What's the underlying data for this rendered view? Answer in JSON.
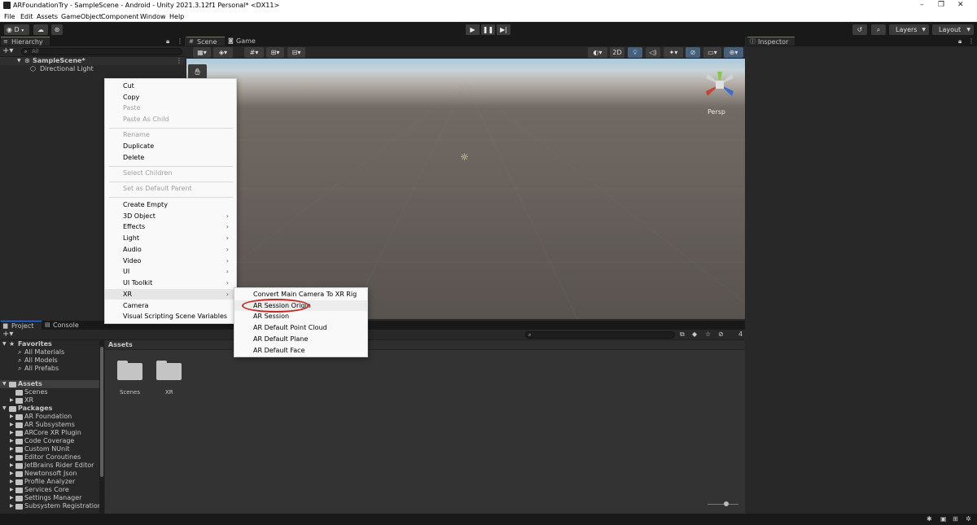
{
  "window": {
    "title": "ARFoundationTry - SampleScene - Android - Unity 2021.3.12f1 Personal* <DX11>",
    "controls": [
      "–",
      "❐",
      "✕"
    ]
  },
  "menubar": [
    "File",
    "Edit",
    "Assets",
    "GameObject",
    "Component",
    "Window",
    "Help"
  ],
  "toolbar": {
    "account_label": "D",
    "layers_label": "Layers",
    "layout_label": "Layout"
  },
  "hierarchy": {
    "tab_label": "Hierarchy",
    "search_placeholder": "All",
    "scene_name": "SampleScene*",
    "children": [
      "Directional Light"
    ]
  },
  "scene": {
    "tabs": [
      "Scene",
      "Game"
    ],
    "mode_2d": "2D",
    "persp_label": "Persp"
  },
  "inspector": {
    "tab_label": "Inspector"
  },
  "context_menu": {
    "items": [
      {
        "label": "Cut",
        "disabled": false
      },
      {
        "label": "Copy",
        "disabled": false
      },
      {
        "label": "Paste",
        "disabled": true
      },
      {
        "label": "Paste As Child",
        "disabled": true
      },
      {
        "label": "Rename",
        "disabled": true
      },
      {
        "label": "Duplicate",
        "disabled": false
      },
      {
        "label": "Delete",
        "disabled": false
      },
      {
        "label": "Select Children",
        "disabled": true
      },
      {
        "label": "Set as Default Parent",
        "disabled": true
      },
      {
        "label": "Create Empty",
        "disabled": false
      },
      {
        "label": "3D Object",
        "disabled": false,
        "submenu": true
      },
      {
        "label": "Effects",
        "disabled": false,
        "submenu": true
      },
      {
        "label": "Light",
        "disabled": false,
        "submenu": true
      },
      {
        "label": "Audio",
        "disabled": false,
        "submenu": true
      },
      {
        "label": "Video",
        "disabled": false,
        "submenu": true
      },
      {
        "label": "UI",
        "disabled": false,
        "submenu": true
      },
      {
        "label": "UI Toolkit",
        "disabled": false,
        "submenu": true
      },
      {
        "label": "XR",
        "disabled": false,
        "submenu": true
      },
      {
        "label": "Camera",
        "disabled": false
      },
      {
        "label": "Visual Scripting Scene Variables",
        "disabled": false
      }
    ]
  },
  "xr_submenu": {
    "items": [
      "Convert Main Camera To XR Rig",
      "AR Session Origin",
      "AR Session",
      "AR Default Point Cloud",
      "AR Default Plane",
      "AR Default Face"
    ],
    "highlighted": "AR Session Origin",
    "highlight_color": "#c62828"
  },
  "project": {
    "tabs": [
      "Project",
      "Console"
    ],
    "favorites_label": "Favorites",
    "favorites": [
      "All Materials",
      "All Models",
      "All Prefabs"
    ],
    "assets_label": "Assets",
    "assets_children": [
      "Scenes",
      "XR"
    ],
    "packages_label": "Packages",
    "packages": [
      "AR Foundation",
      "AR Subsystems",
      "ARCore XR Plugin",
      "Code Coverage",
      "Custom NUnit",
      "Editor Coroutines",
      "JetBrains Rider Editor",
      "Newtonsoft Json",
      "Profile Analyzer",
      "Services Core",
      "Settings Manager",
      "Subsystem Registration"
    ],
    "breadcrumb": "Assets",
    "folders": [
      "Scenes",
      "XR"
    ],
    "hidden_count": "4"
  }
}
